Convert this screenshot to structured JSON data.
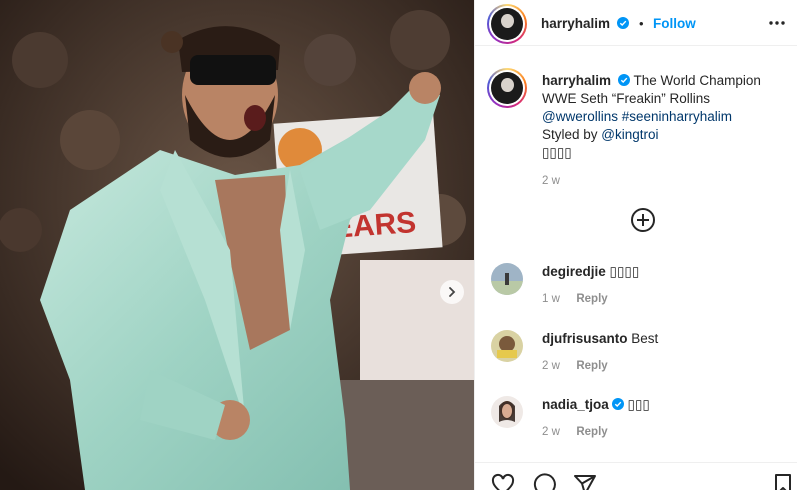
{
  "post": {
    "author": "harryhalim",
    "follow_label": "Follow",
    "separator": "•",
    "media": {
      "has_next": true
    },
    "caption": {
      "username": "harryhalim",
      "line1": "The World Champion WWE Seth “Freakin” Rollins",
      "mentions": "@wwerollins #seeninharryhalim",
      "styled_prefix": "Styled by ",
      "styled_mention": "@kingtroi",
      "emoji_line": "▯▯▯▯",
      "time": "2 w"
    },
    "comments": [
      {
        "username": "degiredjie",
        "text": "▯▯▯▯",
        "time": "1 w",
        "reply": "Reply",
        "verified": false
      },
      {
        "username": "djufrisusanto",
        "text": "Best",
        "time": "2 w",
        "reply": "Reply",
        "verified": false
      },
      {
        "username": "nadia_tjoa",
        "text": "▯▯▯",
        "time": "2 w",
        "reply": "Reply",
        "verified": true
      }
    ],
    "icons": {
      "more": "more-options-icon",
      "next": "chevron-right-icon",
      "add": "add-circle-icon",
      "like": "heart-icon",
      "comment": "comment-icon",
      "share": "share-icon",
      "save": "bookmark-icon"
    },
    "colors": {
      "accent": "#0095f6",
      "link": "#00376b",
      "verified": "#0095f6",
      "muted": "#8e8e8e"
    }
  }
}
